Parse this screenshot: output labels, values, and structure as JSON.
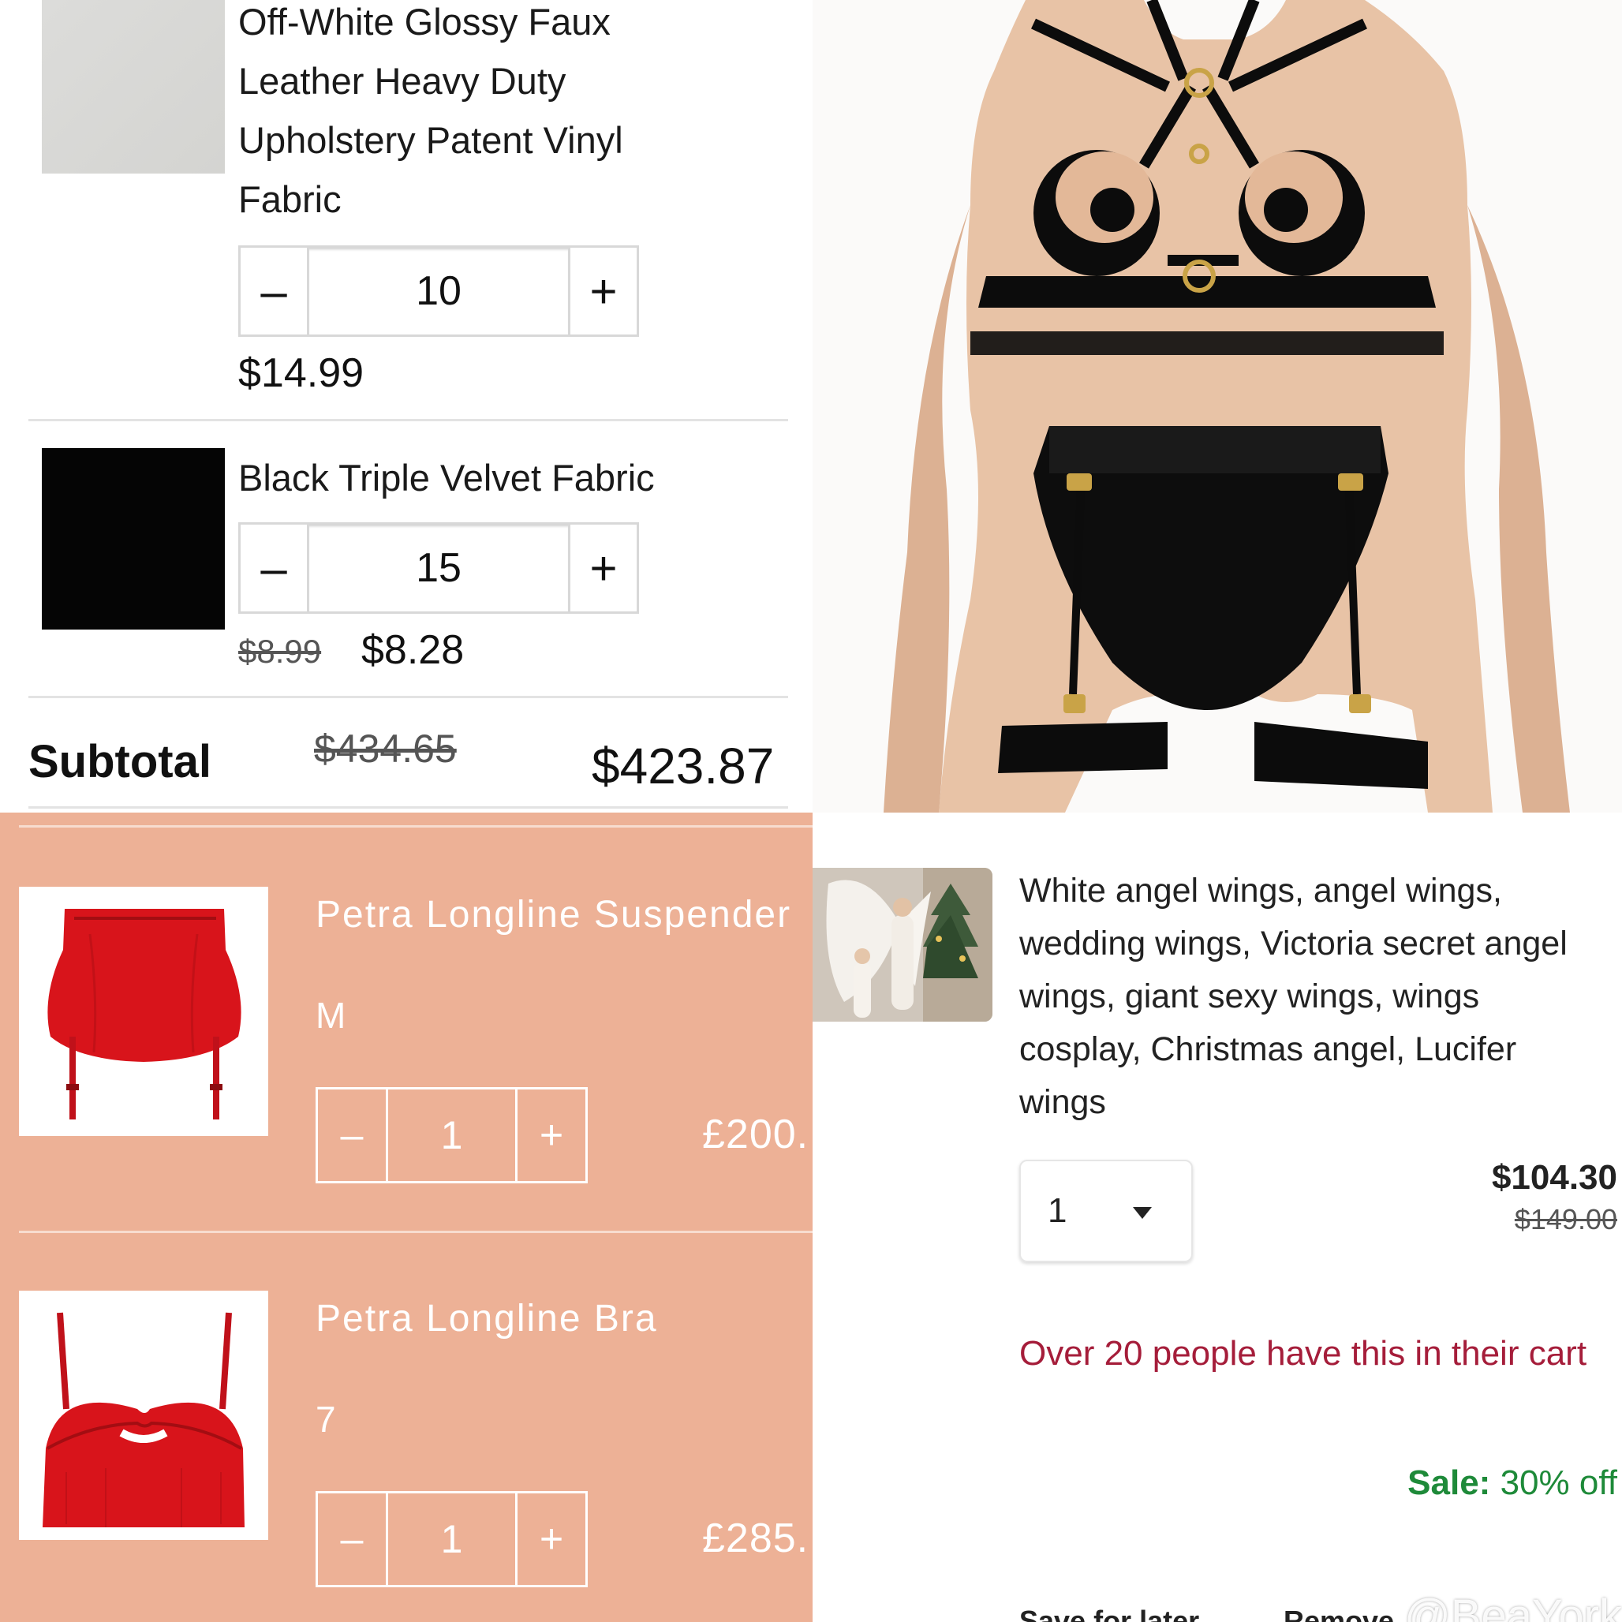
{
  "fabric_cart": {
    "items": [
      {
        "title_lines": [
          "Off-White Glossy Faux",
          "Leather Heavy Duty",
          "Upholstery Patent Vinyl",
          "Fabric"
        ],
        "quantity": "10",
        "price": "$14.99"
      },
      {
        "title": "Black Triple Velvet Fabric",
        "quantity": "15",
        "price_original": "$8.99",
        "price": "$8.28"
      }
    ],
    "minus_label": "–",
    "plus_label": "+",
    "subtotal_label": "Subtotal",
    "subtotal_original": "$434.65",
    "subtotal": "$423.87"
  },
  "lingerie_cart": {
    "items": [
      {
        "title": "Petra Longline Suspender",
        "size": "M",
        "quantity": "1",
        "price": "£200."
      },
      {
        "title": "Petra Longline Bra",
        "size": "7",
        "quantity": "1",
        "price": "£285."
      }
    ],
    "minus_label": "–",
    "plus_label": "+"
  },
  "wings_cart": {
    "title": "White angel wings, angel wings, wedding wings, Victoria secret angel wings, giant sexy wings, wings cosplay, Christmas angel, Lucifer wings",
    "quantity_select": "1",
    "price": "$104.30",
    "price_original": "$149.00",
    "cart_note": "Over 20 people have this in their cart",
    "sale_label": "Sale:",
    "sale_value": "30% off",
    "save_for_later": "Save for later",
    "remove": "Remove"
  },
  "watermark": "@BeaYork",
  "colors": {
    "peach_bg": "#edb196",
    "cart_note": "#a51d3a",
    "sale_green": "#1e8a39",
    "satin_red": "#d8141b"
  }
}
